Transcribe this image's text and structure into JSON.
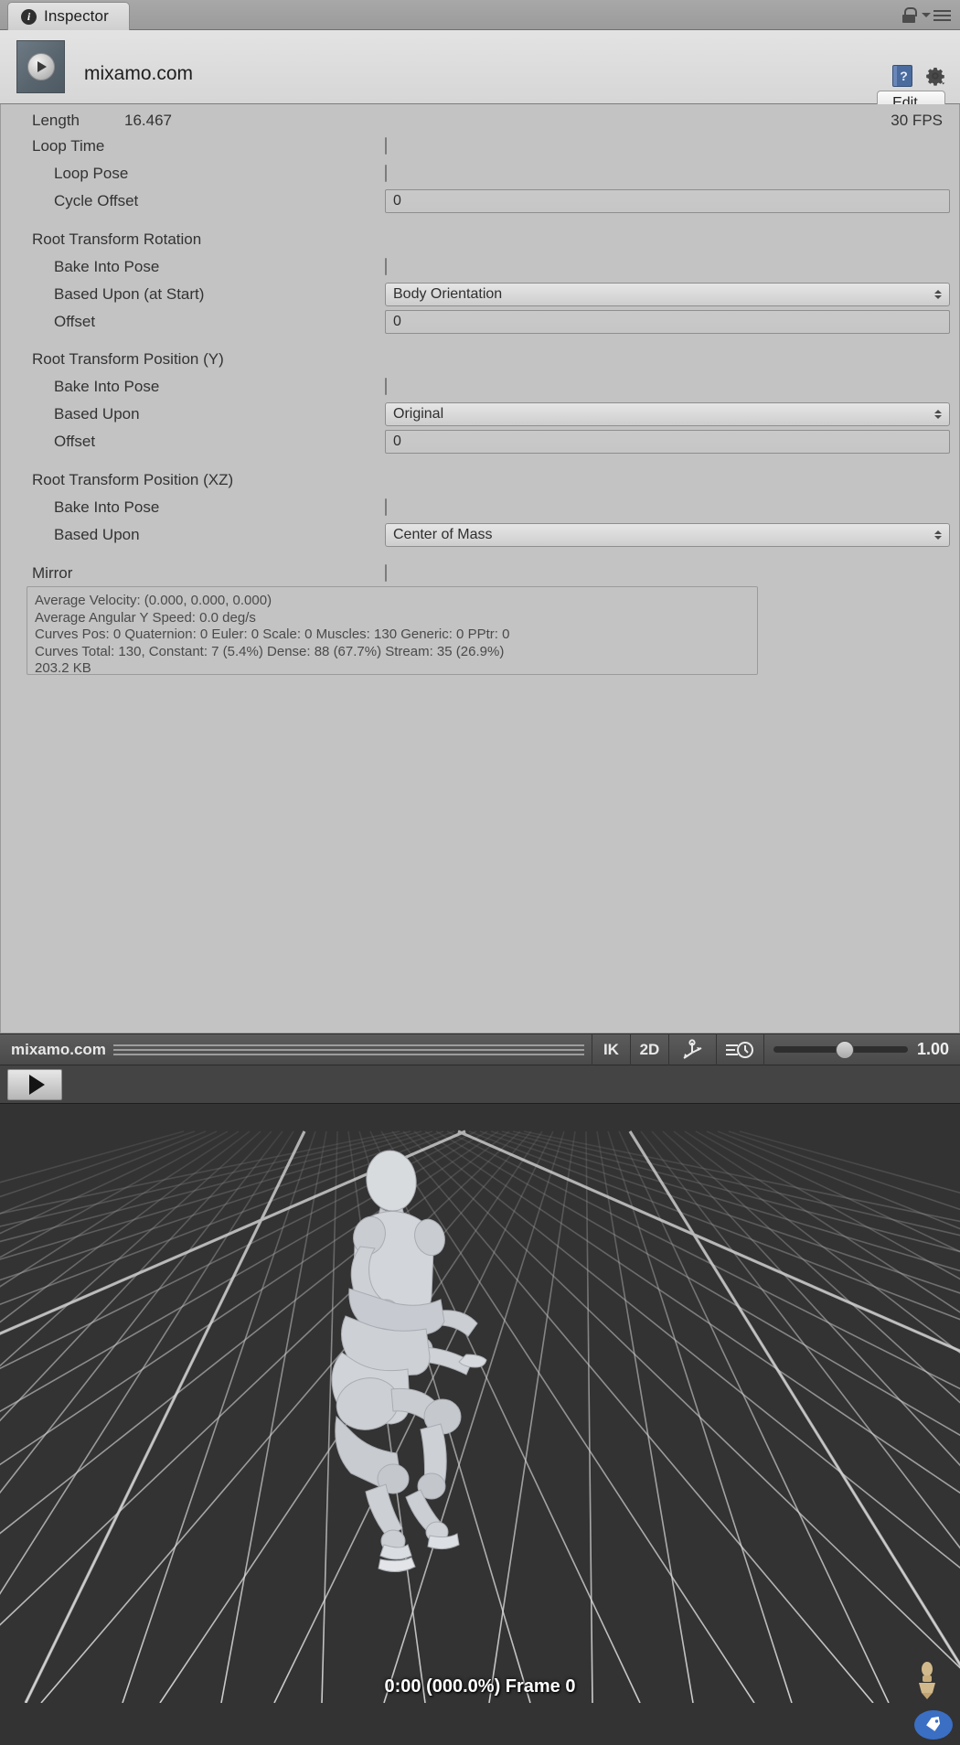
{
  "tab": {
    "label": "Inspector",
    "icon": "info-icon"
  },
  "window_controls": {
    "lock_icon": "lock-icon",
    "menu_icon": "menu-icon"
  },
  "asset": {
    "title": "mixamo.com",
    "thumb_icon": "animation-clip-icon",
    "help_icon": "help-book-icon",
    "gear_icon": "gear-icon",
    "edit_label": "Edit..."
  },
  "properties": {
    "length_label": "Length",
    "length_value": "16.467",
    "fps": "30 FPS",
    "rows": [
      {
        "label": "Loop Time",
        "type": "checkbox",
        "checked": false,
        "indent": 0
      },
      {
        "label": "Loop Pose",
        "type": "checkbox",
        "checked": false,
        "indent": 1
      },
      {
        "label": "Cycle Offset",
        "type": "field",
        "value": "0",
        "indent": 1
      },
      {
        "label": "Root Transform Rotation",
        "type": "section",
        "indent": 0
      },
      {
        "label": "Bake Into Pose",
        "type": "checkbox",
        "checked": false,
        "indent": 1
      },
      {
        "label": "Based Upon (at Start)",
        "type": "dropdown",
        "value": "Body Orientation",
        "indent": 1
      },
      {
        "label": "Offset",
        "type": "field",
        "value": "0",
        "indent": 1
      },
      {
        "label": "Root Transform Position (Y)",
        "type": "section",
        "indent": 0
      },
      {
        "label": "Bake Into Pose",
        "type": "checkbox",
        "checked": false,
        "indent": 1
      },
      {
        "label": "Based Upon",
        "type": "dropdown",
        "value": "Original",
        "indent": 1
      },
      {
        "label": "Offset",
        "type": "field",
        "value": "0",
        "indent": 1
      },
      {
        "label": "Root Transform Position (XZ)",
        "type": "section",
        "indent": 0
      },
      {
        "label": "Bake Into Pose",
        "type": "checkbox",
        "checked": false,
        "indent": 1
      },
      {
        "label": "Based Upon",
        "type": "dropdown",
        "value": "Center of Mass",
        "indent": 1
      },
      {
        "label": "Mirror",
        "type": "checkbox",
        "checked": false,
        "indent": 0
      }
    ]
  },
  "stats": {
    "lines": [
      "Average Velocity: (0.000, 0.000, 0.000)",
      "Average Angular Y Speed: 0.0 deg/s",
      "Curves Pos: 0 Quaternion: 0 Euler: 0 Scale: 0 Muscles: 130 Generic: 0 PPtr: 0",
      "Curves Total: 130, Constant: 7 (5.4%) Dense: 88 (67.7%) Stream: 35 (26.9%)",
      "203.2 KB"
    ]
  },
  "preview_toolbar": {
    "clip_name": "mixamo.com",
    "ik_label": "IK",
    "two_d_label": "2D",
    "avatar_icon": "avatar-pivot-icon",
    "speed_icon": "playback-speed-icon",
    "speed_value": "1.00"
  },
  "playback": {
    "play_icon": "play-icon"
  },
  "viewport": {
    "status": "0:00 (000.0%) Frame 0",
    "tag_icon": "tag-icon",
    "figure_icon": "mannequin-icon",
    "bg_color": "#333333",
    "grid_color": "#9b9b9b"
  }
}
